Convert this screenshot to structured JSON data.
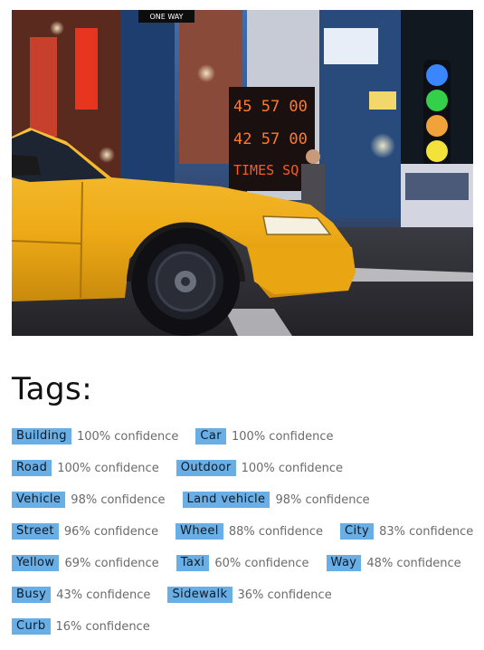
{
  "heading": "Tags:",
  "colors": {
    "tag_bg": "#6aaee6",
    "taxi_yellow": "#f2b21f"
  },
  "tag_rows": [
    [
      {
        "name": "Building",
        "confidence": "100% confidence"
      },
      {
        "name": "Car",
        "confidence": "100% confidence"
      }
    ],
    [
      {
        "name": "Road",
        "confidence": "100% confidence"
      },
      {
        "name": "Outdoor",
        "confidence": "100% confidence"
      }
    ],
    [
      {
        "name": "Vehicle",
        "confidence": "98% confidence"
      },
      {
        "name": "Land vehicle",
        "confidence": "98% confidence"
      }
    ],
    [
      {
        "name": "Street",
        "confidence": "96% confidence"
      },
      {
        "name": "Wheel",
        "confidence": "88% confidence"
      },
      {
        "name": "City",
        "confidence": "83% confidence"
      }
    ],
    [
      {
        "name": "Yellow",
        "confidence": "69% confidence"
      },
      {
        "name": "Taxi",
        "confidence": "60% confidence"
      },
      {
        "name": "Way",
        "confidence": "48% confidence"
      }
    ],
    [
      {
        "name": "Busy",
        "confidence": "43% confidence"
      },
      {
        "name": "Sidewalk",
        "confidence": "36% confidence"
      }
    ],
    [
      {
        "name": "Curb",
        "confidence": "16% confidence"
      }
    ]
  ],
  "photo": {
    "signs": [
      "ONE WAY",
      "45 57 00",
      "42 57 00",
      "TIMES SQ"
    ]
  }
}
